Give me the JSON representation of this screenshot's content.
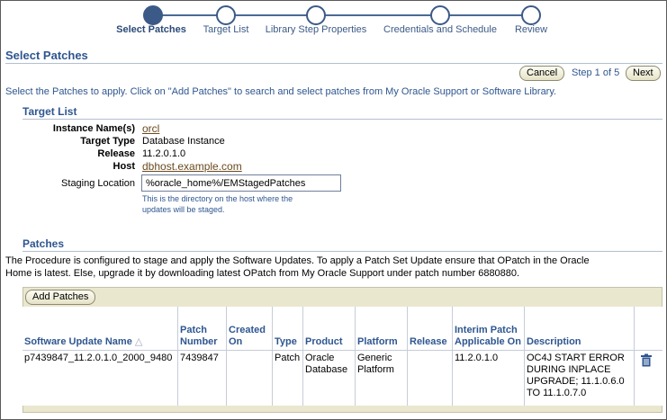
{
  "train": {
    "steps": [
      {
        "label": "Select Patches",
        "active": true
      },
      {
        "label": "Target List",
        "active": false
      },
      {
        "label": "Library Step Properties",
        "active": false
      },
      {
        "label": "Credentials and Schedule",
        "active": false
      },
      {
        "label": "Review",
        "active": false
      }
    ]
  },
  "page": {
    "title": "Select Patches",
    "instructions": "Select the Patches to apply. Click on \"Add Patches\" to search and select patches from My Oracle Support or Software Library."
  },
  "nav": {
    "cancel_label": "Cancel",
    "step_text": "Step 1 of 5",
    "next_label": "Next"
  },
  "target_list": {
    "header": "Target List",
    "instance_label": "Instance Name(s)",
    "instance_value": "orcl",
    "type_label": "Target Type",
    "type_value": "Database Instance",
    "release_label": "Release",
    "release_value": "11.2.0.1.0",
    "host_label": "Host",
    "host_value": "dbhost.example.com",
    "staging_label": "Staging Location",
    "staging_value": "%oracle_home%/EMStagedPatches",
    "staging_hint_1": "This is the directory on the host where the",
    "staging_hint_2": "updates will be staged."
  },
  "patches": {
    "header": "Patches",
    "description_1": "The Procedure is configured to stage and apply the Software Updates. To apply a Patch Set Update ensure that OPatch in the Oracle",
    "description_2": "Home is latest. Else, upgrade it by downloading latest OPatch from My Oracle Support under patch number 6880880.",
    "add_label": "Add Patches",
    "columns": [
      "Software Update Name",
      "Patch Number",
      "Created On",
      "Type",
      "Product",
      "Platform",
      "Release",
      "Interim Patch Applicable On",
      "Description"
    ],
    "sort_indicator": "△",
    "rows": [
      {
        "name": "p7439847_11.2.0.1.0_2000_9480",
        "number": "7439847",
        "created": "",
        "type": "Patch",
        "product": "Oracle Database",
        "platform": "Generic Platform",
        "release": "",
        "applicable": "11.2.0.1.0",
        "description": "OC4J START ERROR DURING INPLACE UPGRADE; 11.1.0.6.0 TO 11.1.0.7.0",
        "delete_icon": "trash-icon"
      }
    ]
  },
  "colors": {
    "accent": "#2e5690",
    "link": "#6a4a1e",
    "panel": "#eae7cf"
  }
}
